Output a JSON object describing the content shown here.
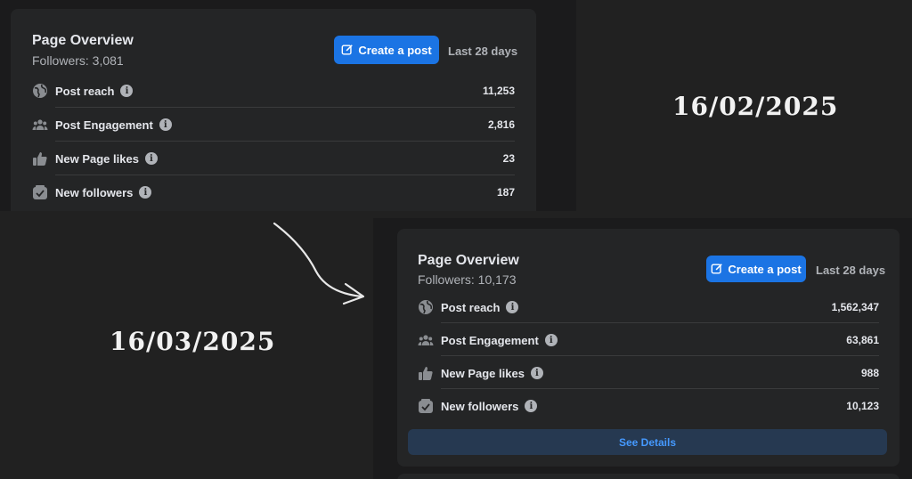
{
  "snapshots": [
    {
      "date": "16/02/2025",
      "title": "Page Overview",
      "followers": "Followers: 3,081",
      "create_label": "Create a post",
      "period": "Last 28 days",
      "metrics": [
        {
          "label": "Post reach",
          "value": "11,253",
          "icon": "globe-icon"
        },
        {
          "label": "Post Engagement",
          "value": "2,816",
          "icon": "people-icon"
        },
        {
          "label": "New Page likes",
          "value": "23",
          "icon": "thumbs-up-icon"
        },
        {
          "label": "New followers",
          "value": "187",
          "icon": "follow-checkbox-icon"
        }
      ]
    },
    {
      "date": "16/03/2025",
      "title": "Page Overview",
      "followers": "Followers: 10,173",
      "create_label": "Create a post",
      "period": "Last 28 days",
      "metrics": [
        {
          "label": "Post reach",
          "value": "1,562,347",
          "icon": "globe-icon"
        },
        {
          "label": "Post Engagement",
          "value": "63,861",
          "icon": "people-icon"
        },
        {
          "label": "New Page likes",
          "value": "988",
          "icon": "thumbs-up-icon"
        },
        {
          "label": "New followers",
          "value": "10,123",
          "icon": "follow-checkbox-icon"
        }
      ],
      "see_details_label": "See Details"
    }
  ],
  "colors": {
    "background": "#212121",
    "panel": "#242526",
    "accent": "#1b74e4",
    "text_primary": "#e4e6eb",
    "text_secondary": "#b0b3b8",
    "see_details_bg": "#263951",
    "see_details_text": "#4599ff"
  }
}
